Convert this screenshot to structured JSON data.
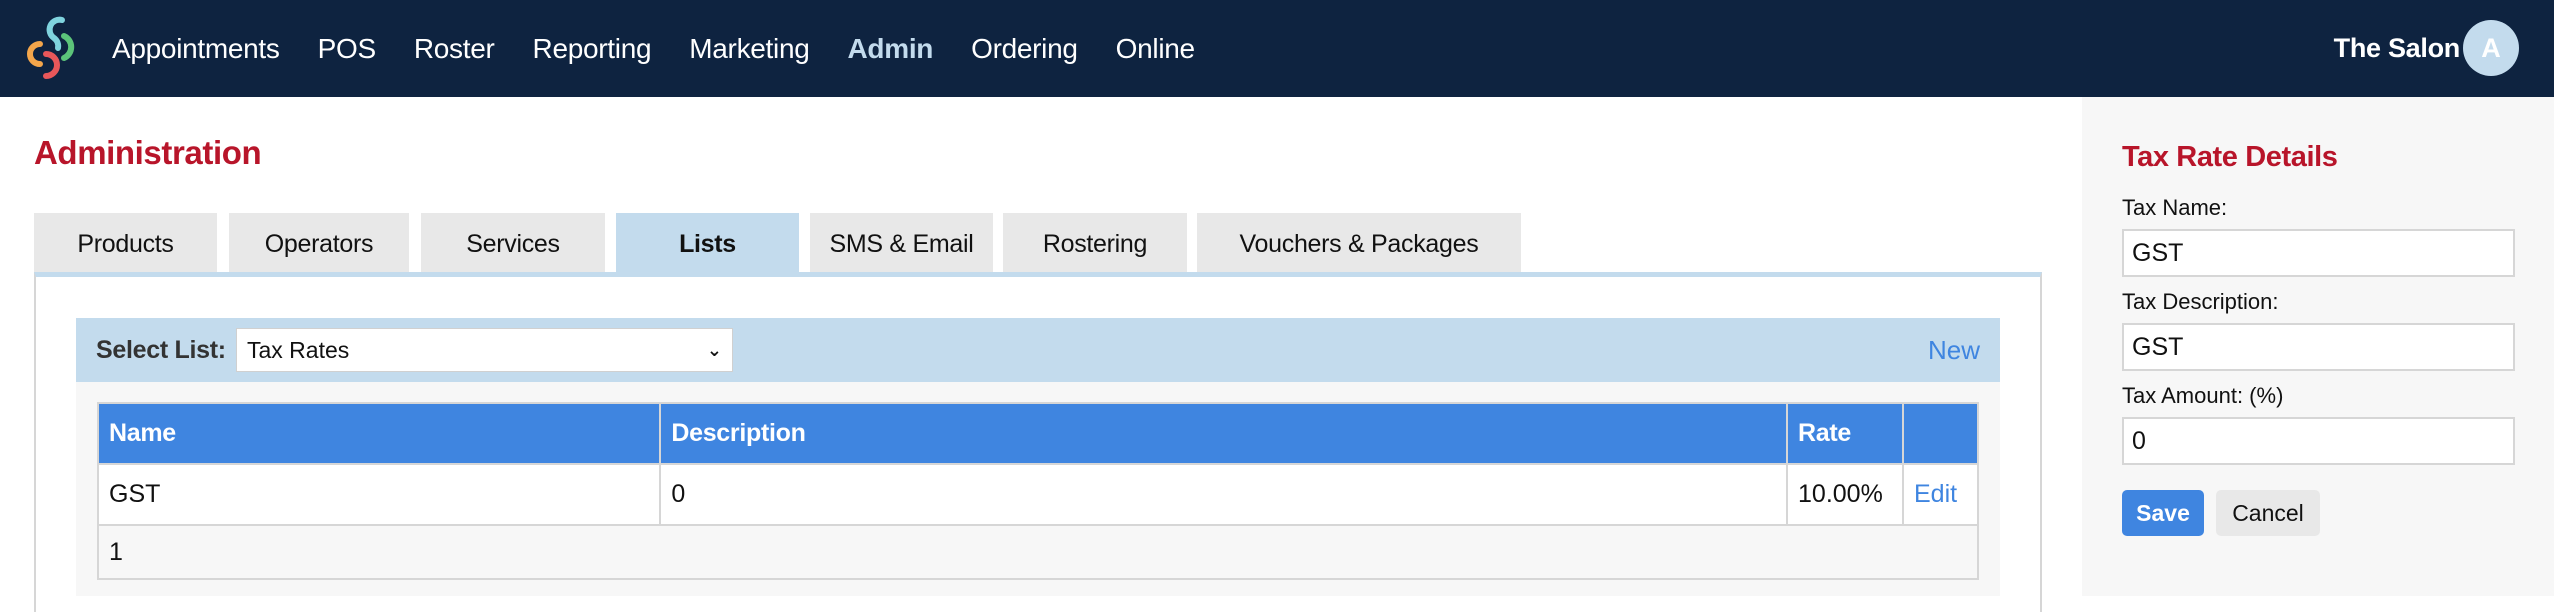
{
  "header": {
    "logo_icon": "interlocking-swirl-logo",
    "logo_colors": [
      "#7fd3de",
      "#5cc47a",
      "#f4a64b",
      "#e8575a"
    ],
    "nav": [
      {
        "label": "Appointments",
        "active": false
      },
      {
        "label": "POS",
        "active": false
      },
      {
        "label": "Roster",
        "active": false
      },
      {
        "label": "Reporting",
        "active": false
      },
      {
        "label": "Marketing",
        "active": false
      },
      {
        "label": "Admin",
        "active": true
      },
      {
        "label": "Ordering",
        "active": false
      },
      {
        "label": "Online",
        "active": false
      }
    ],
    "business_name": "The Salon",
    "avatar_initial": "A"
  },
  "main": {
    "title": "Administration",
    "tabs": [
      {
        "label": "Products",
        "active": false
      },
      {
        "label": "Operators",
        "active": false
      },
      {
        "label": "Services",
        "active": false
      },
      {
        "label": "Lists",
        "active": true
      },
      {
        "label": "SMS & Email",
        "active": false
      },
      {
        "label": "Rostering",
        "active": false
      },
      {
        "label": "Vouchers & Packages",
        "active": false
      }
    ],
    "select_list": {
      "label": "Select List:",
      "value": "Tax Rates",
      "chevron_icon": "chevron-down-icon"
    },
    "new_link": "New",
    "table": {
      "columns": [
        "Name",
        "Description",
        "Rate",
        ""
      ],
      "rows": [
        {
          "name": "GST",
          "description": "0",
          "rate": "10.00%",
          "action": "Edit"
        }
      ],
      "footer": "1"
    }
  },
  "sidebar": {
    "title": "Tax Rate Details",
    "fields": [
      {
        "label": "Tax Name:",
        "value": "GST"
      },
      {
        "label": "Tax Description:",
        "value": "GST"
      },
      {
        "label": "Tax Amount: (%)",
        "value": "0"
      }
    ],
    "save_label": "Save",
    "cancel_label": "Cancel"
  },
  "colors": {
    "header_bg": "#0e2340",
    "accent_blue": "#3f85e0",
    "light_blue": "#c3dbed",
    "title_red": "#b8152a"
  }
}
